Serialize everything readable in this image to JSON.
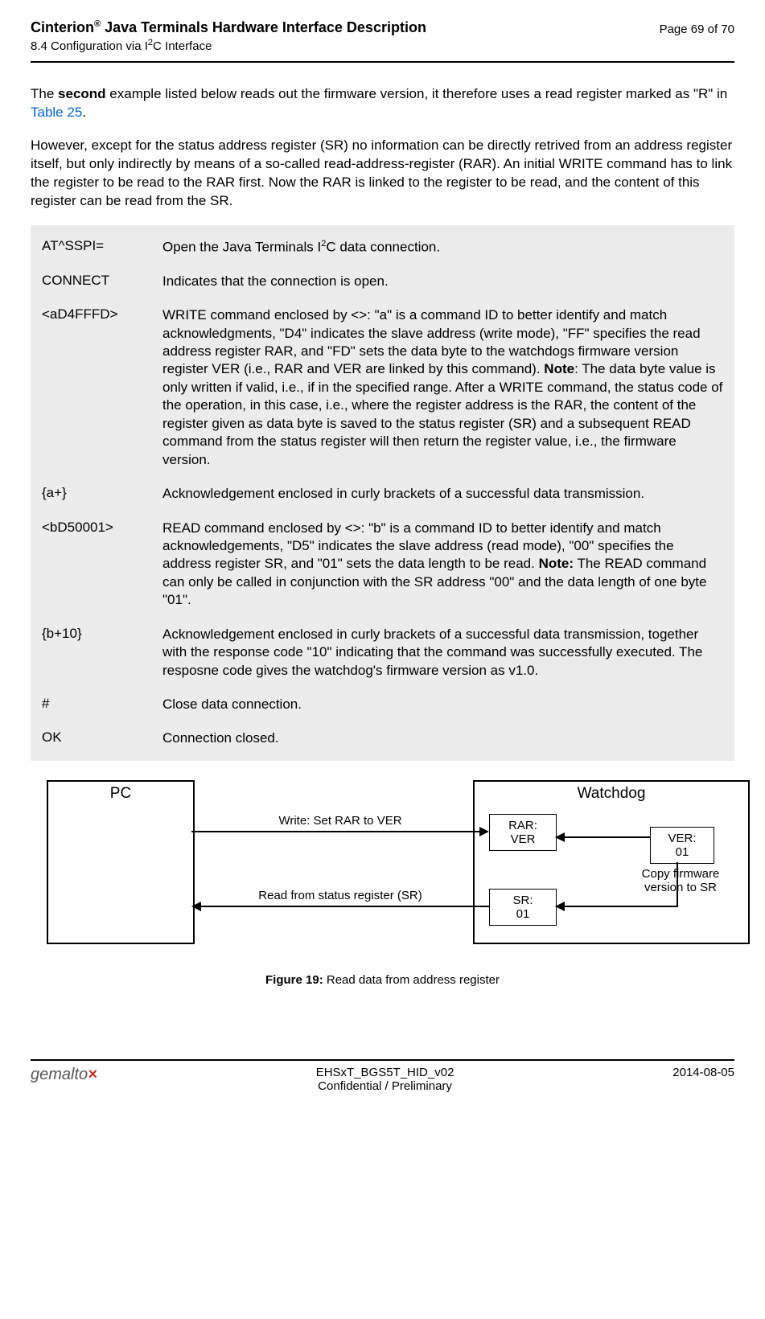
{
  "header": {
    "product": "Cinterion",
    "reg": "®",
    "title_rest": " Java Terminals Hardware Interface Description",
    "section": "8.4 Configuration via I",
    "section_sup": "2",
    "section_rest": "C Interface",
    "page": "Page 69 of 70"
  },
  "para1_a": "The ",
  "para1_b": "second",
  "para1_c": " example listed below reads out the firmware version, it therefore uses a read register marked as \"R\" in ",
  "para1_link": "Table 25",
  "para1_d": ".",
  "para2": "However, except for the status address register (SR) no information can be directly retrived from an address register itself, but only indirectly by means of a so-called read-address-register (RAR). An initial WRITE command has to link the register to be read to the RAR first. Now the RAR is linked to the register to be read, and the content of this register can be read from the SR.",
  "cmds": {
    "r1": {
      "k": "AT^SSPI=",
      "d1": "Open the Java Terminals I",
      "dsup": "2",
      "d2": "C data connection."
    },
    "r2": {
      "k": "CONNECT",
      "d": "Indicates that the connection is open."
    },
    "r3": {
      "k": "<aD4FFFD>",
      "d1": "WRITE command enclosed by <>: \"a\" is a command ID to better identify and match acknowledgments, \"D4\" indicates the slave address (write mode), \"FF\" specifies the read address register RAR, and \"FD\" sets the data byte to the watchdogs firmware version register VER (i.e., RAR and VER are linked by this command). ",
      "note": "Note",
      "d2": ": The data byte value is only written if valid, i.e., if in the specified range. After a WRITE command, the status code of the operation, in this case, i.e., where the register address is the RAR, the content of the register given as data byte is saved to the status register (SR) and a subsequent READ command from the status register will then return the register value, i.e., the firmware version."
    },
    "r4": {
      "k": "{a+}",
      "d": "Acknowledgement enclosed in curly brackets of a successful data transmission."
    },
    "r5": {
      "k": "<bD50001>",
      "d1": "READ command enclosed by <>: \"b\" is a command ID to better identify and match acknowledgements, \"D5\" indicates the slave address (read mode), \"00\" specifies the address register SR, and \"01\" sets the data length to be read. ",
      "note": "Note:",
      "d2": " The READ command can only be called in conjunction with the SR address \"00\" and the data length of one byte \"01\"."
    },
    "r6": {
      "k": "{b+10}",
      "d": "Acknowledgement enclosed in curly brackets of a successful data transmission, together with the response code \"10\" indicating that the command was successfully executed. The resposne code gives the watchdog's firmware version as v1.0."
    },
    "r7": {
      "k": "#",
      "d": "Close data connection."
    },
    "r8": {
      "k": "OK",
      "d": "Connection closed."
    }
  },
  "fig": {
    "pc": "PC",
    "wd": "Watchdog",
    "rar1": "RAR:",
    "rar2": "VER",
    "ver1": "VER:",
    "ver2": "01",
    "sr1": "SR:",
    "sr2": "01",
    "a1": "Write: Set RAR to VER",
    "a2": "Read from status register (SR)",
    "copy": "Copy firmware version to SR"
  },
  "figcap_b": "Figure 19:",
  "figcap_t": "  Read data from address register",
  "footer": {
    "logo": "gemalto",
    "logox": "×",
    "doc": "EHSxT_BGS5T_HID_v02",
    "conf": "Confidential / Preliminary",
    "date": "2014-08-05"
  }
}
